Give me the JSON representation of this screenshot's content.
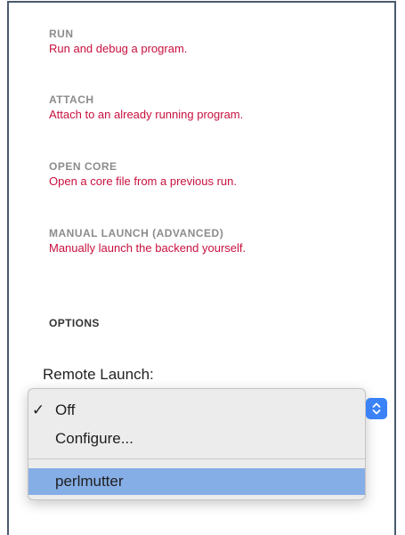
{
  "session_types": [
    {
      "title": "RUN",
      "description": "Run and debug a program."
    },
    {
      "title": "ATTACH",
      "description": "Attach to an already running program."
    },
    {
      "title": "OPEN CORE",
      "description": "Open a core file from a previous run."
    },
    {
      "title": "MANUAL LAUNCH (ADVANCED)",
      "description": "Manually launch the backend yourself."
    }
  ],
  "options": {
    "heading": "OPTIONS",
    "remote_launch_label": "Remote Launch:"
  },
  "remote_launch_menu": {
    "items": [
      {
        "label": "Off",
        "checked": true,
        "check_mark": "✓"
      },
      {
        "label": "Configure...",
        "checked": false
      },
      {
        "label": "perlmutter",
        "highlighted": true
      }
    ],
    "stepper_icon": "chevron-up-down-icon"
  },
  "colors": {
    "title_gray": "#8c8c8c",
    "description_red": "#c8103e",
    "highlight_blue": "#86aee6",
    "stepper_blue": "#3b82f6",
    "frame_border": "#4a5a6e"
  }
}
